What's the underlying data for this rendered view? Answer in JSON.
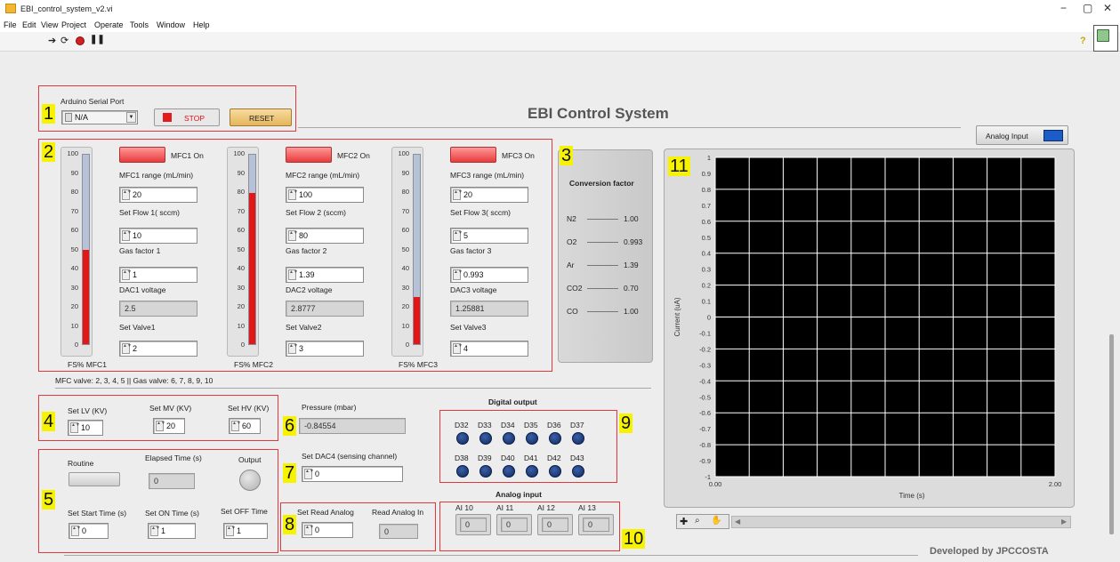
{
  "window": {
    "title": "EBI_control_system_v2.vi"
  },
  "menu": [
    "File",
    "Edit",
    "View",
    "Project",
    "Operate",
    "Tools",
    "Window",
    "Help"
  ],
  "toolbar": {
    "run_icon": "run-arrow-icon",
    "run_cont_icon": "run-continuously-icon",
    "abort_icon": "abort-icon",
    "pause_icon": "pause-icon",
    "help_icon": "help-icon"
  },
  "title": "EBI Control System",
  "section_numbers": [
    "1",
    "2",
    "3",
    "4",
    "5",
    "6",
    "7",
    "8",
    "9",
    "10",
    "11"
  ],
  "serial": {
    "label": "Arduino Serial Port",
    "value": "N/A",
    "stop_label": "STOP",
    "reset_label": "RESET"
  },
  "tank_ticks": [
    "100",
    "90",
    "80",
    "70",
    "60",
    "50",
    "40",
    "30",
    "20",
    "10",
    "0"
  ],
  "mfc": [
    {
      "button": "MFC1 On",
      "range_label": "MFC1 range (mL/min)",
      "range": "20",
      "flow_label": "Set Flow 1( sccm)",
      "flow": "10",
      "gas_label": "Gas factor 1",
      "gas": "1",
      "dac_label": "DAC1 voltage",
      "dac": "2.5",
      "valve_label": "Set Valve1",
      "valve": "2",
      "tank_label": "FS% MFC1",
      "level": 50
    },
    {
      "button": "MFC2 On",
      "range_label": "MFC2 range (mL/min)",
      "range": "100",
      "flow_label": "Set Flow 2 (sccm)",
      "flow": "80",
      "gas_label": "Gas factor 2",
      "gas": "1.39",
      "dac_label": "DAC2 voltage",
      "dac": "2.8777",
      "valve_label": "Set Valve2",
      "valve": "3",
      "tank_label": "FS% MFC2",
      "level": 80
    },
    {
      "button": "MFC3 On",
      "range_label": "MFC3 range (mL/min)",
      "range": "20",
      "flow_label": "Set Flow 3( sccm)",
      "flow": "5",
      "gas_label": "Gas factor 3",
      "gas": "0.993",
      "dac_label": "DAC3 voltage",
      "dac": "1.25881",
      "valve_label": "Set Valve3",
      "valve": "4",
      "tank_label": "FS% MFC3",
      "level": 25
    }
  ],
  "valve_note": "MFC valve: 2, 3, 4, 5 || Gas valve: 6, 7, 8, 9, 10",
  "conversion": {
    "title": "Conversion factor",
    "rows": [
      {
        "gas": "N2",
        "factor": "1.00"
      },
      {
        "gas": "O2",
        "factor": "0.993"
      },
      {
        "gas": "Ar",
        "factor": "1.39"
      },
      {
        "gas": "CO2",
        "factor": "0.70"
      },
      {
        "gas": "CO",
        "factor": "1.00"
      }
    ]
  },
  "hv": {
    "lv_label": "Set LV (KV)",
    "lv": "10",
    "mv_label": "Set MV (KV)",
    "mv": "20",
    "hv_label": "Set HV (KV)",
    "hv": "60"
  },
  "pressure": {
    "label": "Pressure (mbar)",
    "value": "-0.84554"
  },
  "dac4": {
    "label": "Set DAC4 (sensing channel)",
    "value": "0"
  },
  "routine": {
    "routine_label": "Routine",
    "elapsed_label": "Elapsed Time (s)",
    "elapsed": "0",
    "output_label": "Output",
    "start_label": "Set Start Time (s)",
    "start": "0",
    "on_label": "Set ON Time (s)",
    "on": "1",
    "off_label": "Set OFF Time",
    "off": "1"
  },
  "analog_read": {
    "set_label": "Set Read Analog",
    "set_value": "0",
    "read_label": "Read Analog In",
    "read_value": "0"
  },
  "digital_output": {
    "title": "Digital output",
    "row1": [
      "D32",
      "D33",
      "D34",
      "D35",
      "D36",
      "D37"
    ],
    "row2": [
      "D38",
      "D39",
      "D40",
      "D41",
      "D42",
      "D43"
    ]
  },
  "analog_input": {
    "title": "Analog input",
    "channels": [
      {
        "name": "AI 10",
        "value": "0"
      },
      {
        "name": "AI 11",
        "value": "0"
      },
      {
        "name": "AI 12",
        "value": "0"
      },
      {
        "name": "AI 13",
        "value": "0"
      }
    ]
  },
  "graph": {
    "button": "Analog Input",
    "ylabel": "Current (uA)",
    "xlabel": "Time (s)",
    "yticks": [
      "1",
      "0.9",
      "0.8",
      "0.7",
      "0.6",
      "0.5",
      "0.4",
      "0.3",
      "0.2",
      "0.1",
      "0",
      "-0.1",
      "-0.2",
      "-0.3",
      "-0.4",
      "-0.5",
      "-0.6",
      "-0.7",
      "-0.8",
      "-0.9",
      "-1"
    ],
    "xticks": [
      "0.00",
      "2.00"
    ]
  },
  "footer": "Developed by JPCCOSTA"
}
